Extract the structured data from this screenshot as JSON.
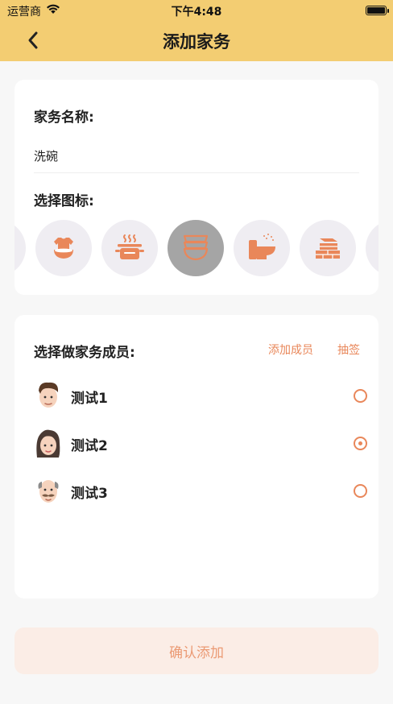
{
  "status_bar": {
    "carrier": "运营商",
    "time": "下午4:48"
  },
  "header": {
    "title": "添加家务"
  },
  "form": {
    "name_label": "家务名称:",
    "name_value": "洗碗",
    "icon_label": "选择图标:",
    "icons": [
      "partial-icon",
      "tshirt-icon",
      "pot-icon",
      "bowls-icon",
      "toilet-icon",
      "bricks-icon",
      "partial-icon"
    ],
    "selected_icon": "bowls-icon"
  },
  "members": {
    "title": "选择做家务成员:",
    "add_member_label": "添加成员",
    "draw_label": "抽签",
    "items": [
      {
        "name": "测试1",
        "avatar": "man-avatar",
        "selected": false
      },
      {
        "name": "测试2",
        "avatar": "woman-avatar",
        "selected": true
      },
      {
        "name": "测试3",
        "avatar": "old-man-avatar",
        "selected": false
      }
    ]
  },
  "confirm_label": "确认添加",
  "colors": {
    "header_bg": "#f3cd72",
    "accent": "#e9875a",
    "selected_icon_bg": "#a5a5a5"
  }
}
